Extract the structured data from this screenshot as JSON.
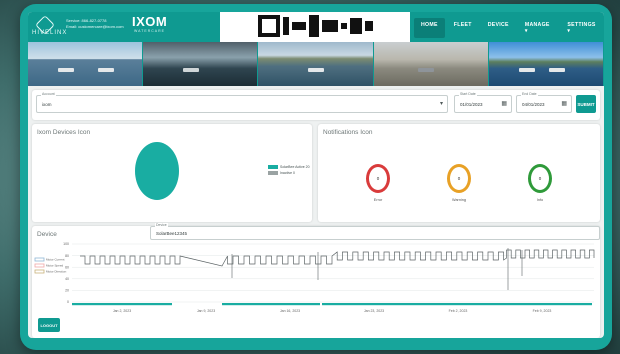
{
  "header": {
    "brand_name": "HIVELINX",
    "service_line": "Service: 866-827-0778",
    "email_line": "Email: customercare@ixom.com",
    "product_name": "IXOM",
    "product_sub": "WATERCARE",
    "nav": [
      {
        "label": "HOME",
        "active": true
      },
      {
        "label": "FLEET",
        "active": false
      },
      {
        "label": "DEVICE",
        "active": false
      },
      {
        "label": "MANAGE ▾",
        "active": false
      },
      {
        "label": "SETTINGS ▾",
        "active": false
      }
    ]
  },
  "filters": {
    "account_label": "Account",
    "account_value": "ixom",
    "start_label": "Start Date",
    "start_value": "01/01/2023",
    "end_label": "End Date",
    "end_value": "04/01/2023",
    "submit_label": "SUBMIT"
  },
  "devices_panel": {
    "title": "Ixom Devices Icon",
    "legend": [
      {
        "label": "SolarBee Active 20",
        "color": "#19ada2"
      },
      {
        "label": "Inactive 0",
        "color": "#9aa3a3"
      }
    ]
  },
  "notifications_panel": {
    "title": "Notifications Icon",
    "items": [
      {
        "label": "Error",
        "value": "0",
        "color": "#d93b3b"
      },
      {
        "label": "Warning",
        "value": "0",
        "color": "#e8a126"
      },
      {
        "label": "Info",
        "value": "0",
        "color": "#2f9a3a"
      }
    ]
  },
  "device_panel": {
    "title": "Device",
    "select_label": "Device",
    "select_value": "SolarBee12345",
    "logout_label": "LOGOUT"
  },
  "chart_data": {
    "type": "line",
    "legend": [
      "Motor Current",
      "Motor Speed",
      "Motor Direction"
    ],
    "legend_colors": [
      "#8fb6d6",
      "#f0a8a8",
      "#c8b27a"
    ],
    "x_ticks": [
      "Jan 2, 2023",
      "Jan 9, 2023",
      "Jan 16, 2023",
      "Jan 23, 2023",
      "Feb 2, 2023",
      "Feb 9, 2023"
    ],
    "y_ticks": [
      "100",
      "80",
      "60",
      "40",
      "20",
      "0"
    ]
  }
}
